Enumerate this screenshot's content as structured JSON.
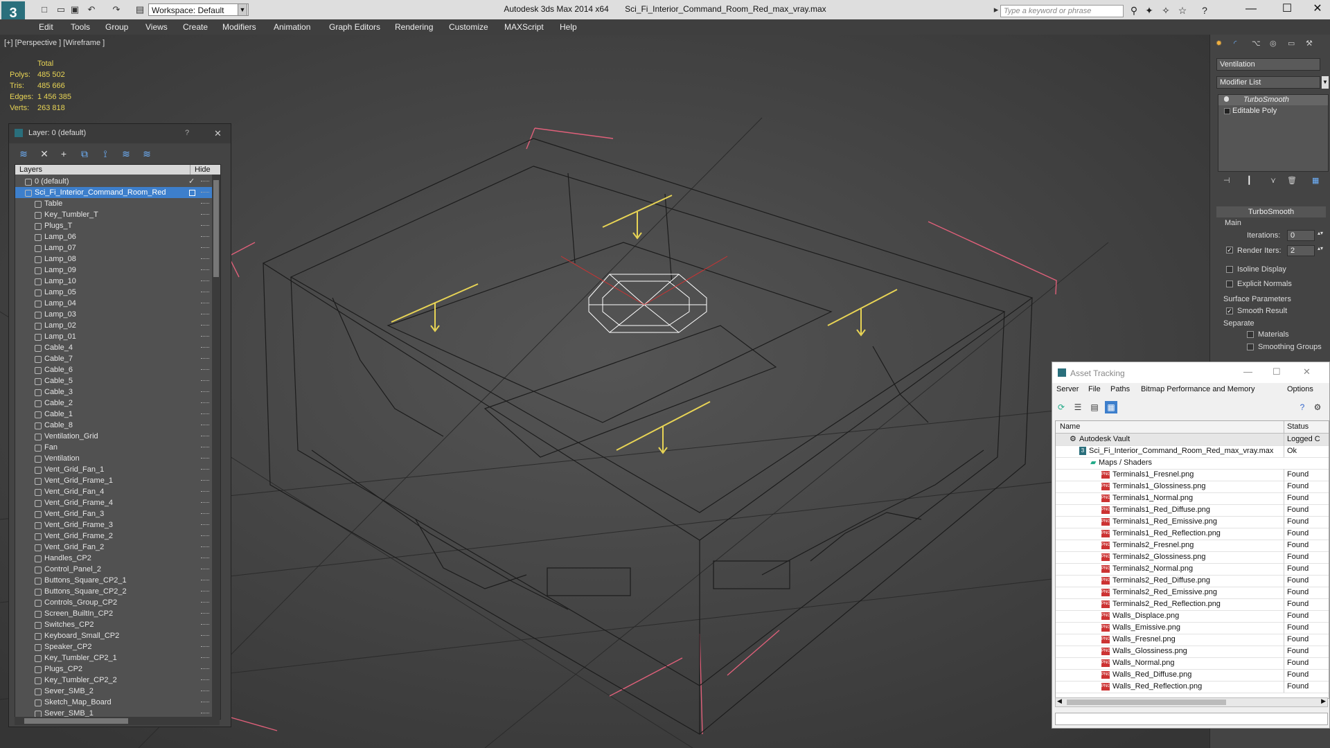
{
  "window": {
    "app_title": "Autodesk 3ds Max  2014 x64",
    "file_title": "Sci_Fi_Interior_Command_Room_Red_max_vray.max",
    "workspace": "Workspace: Default",
    "search_placeholder": "Type a keyword or phrase",
    "minimize": "—",
    "maximize": "☐",
    "close": "✕"
  },
  "menu": [
    "Edit",
    "Tools",
    "Group",
    "Views",
    "Create",
    "Modifiers",
    "Animation",
    "Graph Editors",
    "Rendering",
    "Customize",
    "MAXScript",
    "Help"
  ],
  "viewport": {
    "label": "[+] [Perspective ] [Wireframe ]",
    "stats": {
      "header": "Total",
      "rows": [
        {
          "label": "Polys:",
          "value": "485 502"
        },
        {
          "label": "Tris:",
          "value": "485 666"
        },
        {
          "label": "Edges:",
          "value": "1 456 385"
        },
        {
          "label": "Verts:",
          "value": "263 818"
        }
      ]
    }
  },
  "layer_panel": {
    "title": "Layer: 0 (default)",
    "help": "?",
    "close": "✕",
    "col_layers": "Layers",
    "col_hide": "Hide",
    "rows": [
      "0 (default)",
      "Sci_Fi_Interior_Command_Room_Red",
      "Table",
      "Key_Tumbler_T",
      "Plugs_T",
      "Lamp_06",
      "Lamp_07",
      "Lamp_08",
      "Lamp_09",
      "Lamp_10",
      "Lamp_05",
      "Lamp_04",
      "Lamp_03",
      "Lamp_02",
      "Lamp_01",
      "Cable_4",
      "Cable_7",
      "Cable_6",
      "Cable_5",
      "Cable_3",
      "Cable_2",
      "Cable_1",
      "Cable_8",
      "Ventilation_Grid",
      "Fan",
      "Ventilation",
      "Vent_Grid_Fan_1",
      "Vent_Grid_Frame_1",
      "Vent_Grid_Fan_4",
      "Vent_Grid_Frame_4",
      "Vent_Grid_Fan_3",
      "Vent_Grid_Frame_3",
      "Vent_Grid_Frame_2",
      "Vent_Grid_Fan_2",
      "Handles_CP2",
      "Control_Panel_2",
      "Buttons_Square_CP2_1",
      "Buttons_Square_CP2_2",
      "Controls_Group_CP2",
      "Screen_BuiltIn_CP2",
      "Switches_CP2",
      "Keyboard_Small_CP2",
      "Speaker_CP2",
      "Key_Tumbler_CP2_1",
      "Plugs_CP2",
      "Key_Tumbler_CP2_2",
      "Sever_SMB_2",
      "Sketch_Map_Board",
      "Sever_SMB_1"
    ]
  },
  "command_panel": {
    "object_name": "Ventilation",
    "modifier_list": "Modifier List",
    "stack": [
      "TurboSmooth",
      "Editable Poly"
    ],
    "rollout_title": "TurboSmooth",
    "main_label": "Main",
    "iterations_label": "Iterations:",
    "iterations_value": "0",
    "render_iters_label": "Render Iters:",
    "render_iters_value": "2",
    "isoline": "Isoline Display",
    "explicit": "Explicit Normals",
    "surface_params": "Surface Parameters",
    "smooth_result": "Smooth Result",
    "separate": "Separate",
    "materials": "Materials",
    "smoothing_groups": "Smoothing Groups"
  },
  "asset_tracking": {
    "title": "Asset Tracking",
    "menu": [
      "Server",
      "File",
      "Paths",
      "Bitmap Performance and Memory",
      "Options"
    ],
    "col_name": "Name",
    "col_status": "Status",
    "vault": {
      "name": "Autodesk Vault",
      "status": "Logged C"
    },
    "file": {
      "name": "Sci_Fi_Interior_Command_Room_Red_max_vray.max",
      "status": "Ok"
    },
    "folder": "Maps / Shaders",
    "maps": [
      {
        "name": "Terminals1_Fresnel.png",
        "status": "Found"
      },
      {
        "name": "Terminals1_Glossiness.png",
        "status": "Found"
      },
      {
        "name": "Terminals1_Normal.png",
        "status": "Found"
      },
      {
        "name": "Terminals1_Red_Diffuse.png",
        "status": "Found"
      },
      {
        "name": "Terminals1_Red_Emissive.png",
        "status": "Found"
      },
      {
        "name": "Terminals1_Red_Reflection.png",
        "status": "Found"
      },
      {
        "name": "Terminals2_Fresnel.png",
        "status": "Found"
      },
      {
        "name": "Terminals2_Glossiness.png",
        "status": "Found"
      },
      {
        "name": "Terminals2_Normal.png",
        "status": "Found"
      },
      {
        "name": "Terminals2_Red_Diffuse.png",
        "status": "Found"
      },
      {
        "name": "Terminals2_Red_Emissive.png",
        "status": "Found"
      },
      {
        "name": "Terminals2_Red_Reflection.png",
        "status": "Found"
      },
      {
        "name": "Walls_Displace.png",
        "status": "Found"
      },
      {
        "name": "Walls_Emissive.png",
        "status": "Found"
      },
      {
        "name": "Walls_Fresnel.png",
        "status": "Found"
      },
      {
        "name": "Walls_Glossiness.png",
        "status": "Found"
      },
      {
        "name": "Walls_Normal.png",
        "status": "Found"
      },
      {
        "name": "Walls_Red_Diffuse.png",
        "status": "Found"
      },
      {
        "name": "Walls_Red_Reflection.png",
        "status": "Found"
      }
    ]
  }
}
